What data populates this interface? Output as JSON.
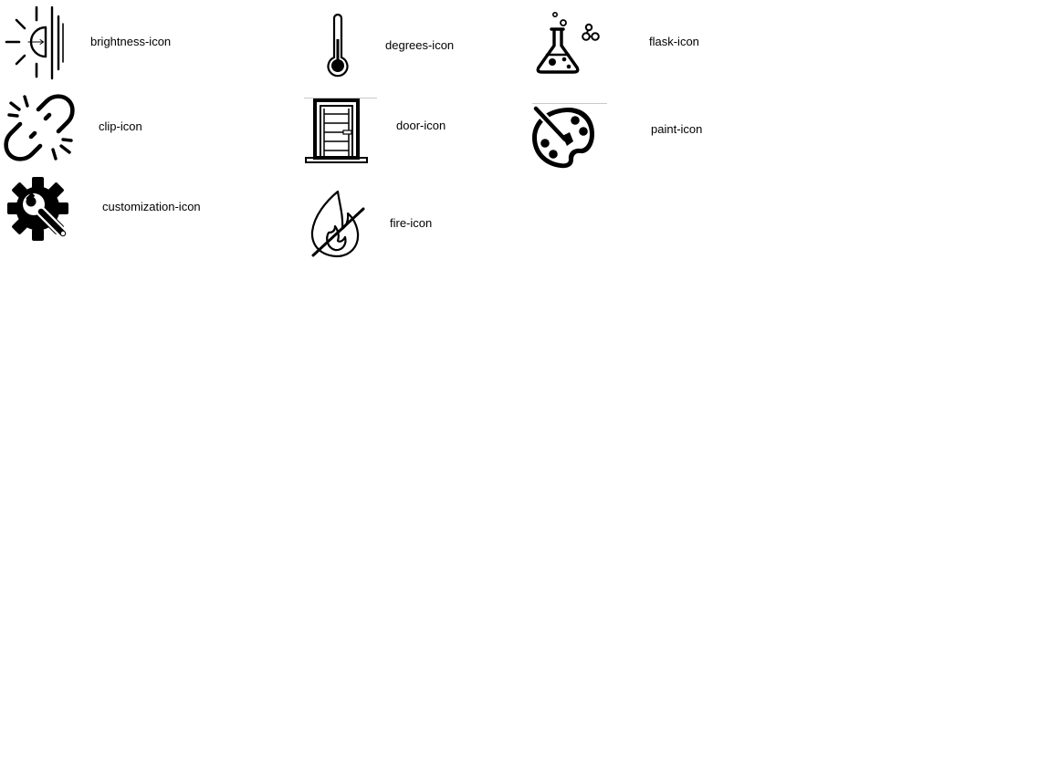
{
  "icons": [
    {
      "label": "brightness-icon"
    },
    {
      "label": "clip-icon"
    },
    {
      "label": "customization-icon"
    },
    {
      "label": "degrees-icon"
    },
    {
      "label": "door-icon"
    },
    {
      "label": "fire-icon"
    },
    {
      "label": "flask-icon"
    },
    {
      "label": "paint-icon"
    }
  ],
  "colors": {
    "background": "#ffffff",
    "icon": "#000000",
    "text": "#000000"
  }
}
